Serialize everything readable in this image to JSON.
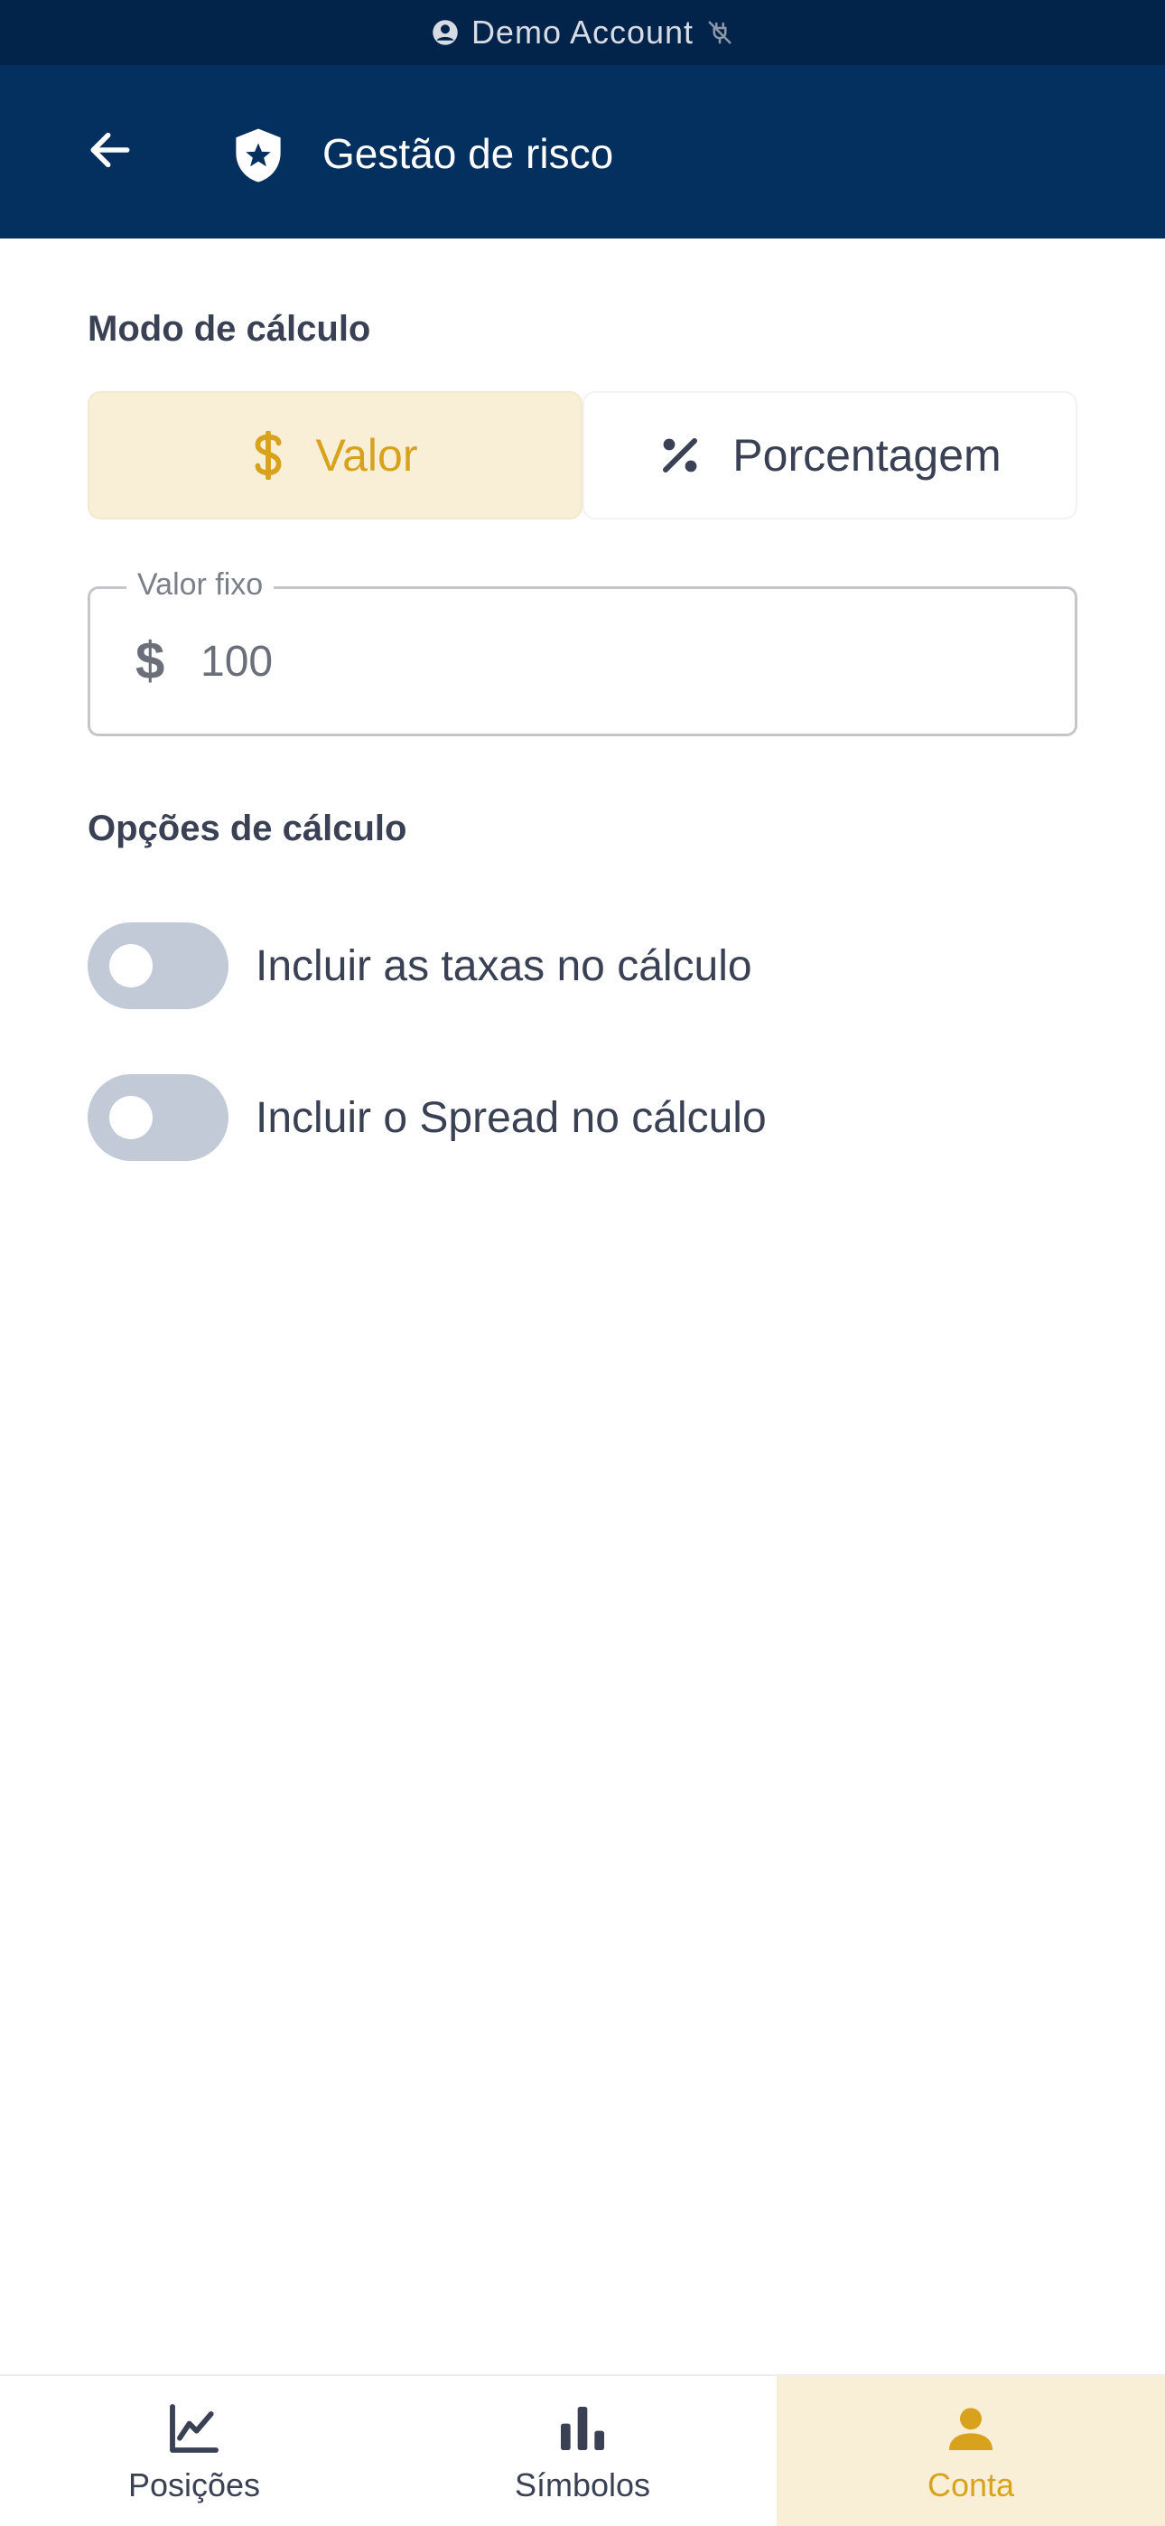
{
  "banner": {
    "text": "Demo Account",
    "account_icon": "account-circle-icon",
    "status_icon": "disconnected-plug-icon"
  },
  "header": {
    "title": "Gestão de risco",
    "back_icon": "arrow-left-icon",
    "title_icon": "shield-star-icon"
  },
  "calc_mode": {
    "label": "Modo de cálculo",
    "options": [
      {
        "label": "Valor",
        "icon": "dollar-icon",
        "selected": true
      },
      {
        "label": "Porcentagem",
        "icon": "percent-icon",
        "selected": false
      }
    ]
  },
  "fixed_value": {
    "legend": "Valor fixo",
    "prefix": "$",
    "value": "100"
  },
  "calc_options": {
    "label": "Opções de cálculo",
    "toggles": [
      {
        "label": "Incluir as taxas no cálculo",
        "on": false
      },
      {
        "label": "Incluir o Spread no cálculo",
        "on": false
      }
    ]
  },
  "bottom_nav": {
    "items": [
      {
        "label": "Posições",
        "icon": "line-chart-icon",
        "active": false
      },
      {
        "label": "Símbolos",
        "icon": "bar-chart-icon",
        "active": false
      },
      {
        "label": "Conta",
        "icon": "person-icon",
        "active": true
      }
    ]
  },
  "colors": {
    "banner_bg": "#03244a",
    "header_bg": "#03305f",
    "accent": "#d9a21c",
    "accent_bg": "#f9efd7",
    "text": "#3a4154",
    "toggle_off": "#c2cad7"
  }
}
